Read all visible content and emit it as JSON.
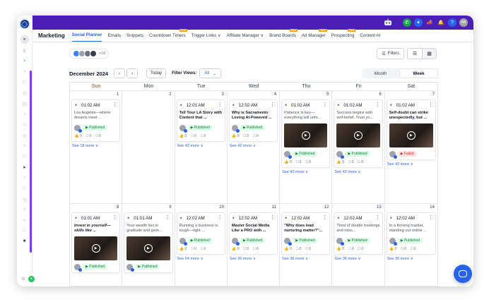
{
  "nav": {
    "title": "Marketing",
    "tabs": [
      {
        "label": "Social Planner",
        "active": true,
        "new": ""
      },
      {
        "label": "Emails",
        "active": false,
        "new": ""
      },
      {
        "label": "Snippets",
        "active": false,
        "new": ""
      },
      {
        "label": "Countdown Timers",
        "active": false,
        "new": "New"
      },
      {
        "label": "Trigger Links ∨",
        "active": false,
        "new": ""
      },
      {
        "label": "Affiliate Manager ∨",
        "active": false,
        "new": ""
      },
      {
        "label": "Brand Boards",
        "active": false,
        "new": "New"
      },
      {
        "label": "Ad Manager",
        "active": false,
        "new": "New"
      },
      {
        "label": "Prospecting",
        "active": false,
        "new": "New"
      },
      {
        "label": "Content AI",
        "active": false,
        "new": ""
      }
    ]
  },
  "toolbar": {
    "accounts_more": "+16",
    "filters_label": "Filters"
  },
  "daterow": {
    "month": "December 2024",
    "prev": "‹",
    "next": "›",
    "today": "Today",
    "filter_views_label": "Filter Views:",
    "filter_views_value": "All",
    "view_month": "Month",
    "view_week": "Week"
  },
  "calendar": {
    "weekdays": [
      "Sun",
      "Mon",
      "Tue",
      "Wed",
      "Thu",
      "Fri",
      "Sat"
    ],
    "weeks": [
      {
        "days": [
          {
            "num": "1",
            "post": null,
            "see_more": "See 18 more ∨"
          },
          {
            "num": "2",
            "post": null,
            "see_more": ""
          },
          {
            "num": "3",
            "post": {
              "time": "12:01 AM",
              "text": "Tell Your LA Story with Content that ...",
              "style": "bold",
              "media": false,
              "status": "Published",
              "likes": "0",
              "comments": "0",
              "shares": "0"
            },
            "see_more": "See 42 more ∨"
          },
          {
            "num": "4",
            "post": {
              "time": "12:02 AM",
              "text": "Why is Sacramento Loving AI-Powered ...",
              "style": "bold",
              "media": false,
              "status": "Published",
              "likes": "0",
              "comments": "0",
              "shares": "0"
            },
            "see_more": "See 42 more ∨"
          },
          {
            "num": "5",
            "post": {
              "time": "01:02 AM",
              "text": "Patience is key— everything will unfo...",
              "style": "normal",
              "media": true,
              "status": "Published",
              "likes": "0",
              "comments": "0",
              "shares": "0"
            },
            "see_more": "See 42 more ∨"
          },
          {
            "num": "6",
            "post": {
              "time": "01:02 AM",
              "text": "Success begins with self-belief. Trust yo...",
              "style": "normal",
              "media": true,
              "status": "Published",
              "likes": "0",
              "comments": "0",
              "shares": "0"
            },
            "see_more": "See 42 more ∨"
          },
          {
            "num": "7",
            "post": {
              "time": "01:02 AM",
              "text": "Self-doubt can strike unexpectedly, but ...",
              "style": "bold",
              "media": true,
              "status": "Failed",
              "likes": "",
              "comments": "",
              "shares": ""
            },
            "see_more": "See 42 more ∨"
          }
        ],
        "sun_post": {
          "time": "01:02 AM",
          "text": "Los Angeles—where dreams meet ...",
          "style": "normal",
          "media": false,
          "status": "Published",
          "likes": "0",
          "comments": "0",
          "shares": "0"
        }
      },
      {
        "days": [
          {
            "num": "8",
            "post": {
              "time": "01:01 AM",
              "text": "Invest in yourself— skills like ...",
              "style": "ital",
              "media": true,
              "status": "Published",
              "likes": "",
              "comments": "",
              "shares": ""
            },
            "see_more": ""
          },
          {
            "num": "9",
            "post": {
              "time": "01:01 AM",
              "text": "Your wealth lies in gratitude and givin...",
              "style": "normal",
              "media": true,
              "status": "Published",
              "likes": "",
              "comments": "",
              "shares": ""
            },
            "see_more": ""
          },
          {
            "num": "10",
            "post": {
              "time": "12:02 AM",
              "text": "Running a business is tough—tight ...",
              "style": "normal",
              "media": false,
              "status": "Published",
              "likes": "0",
              "comments": "0",
              "shares": "0"
            },
            "see_more": "See 54 more ∨"
          },
          {
            "num": "11",
            "post": {
              "time": "12:02 AM",
              "text": "Master Social Media Like a PRO with ...",
              "style": "bold",
              "media": false,
              "status": "Published",
              "likes": "0",
              "comments": "0",
              "shares": "0"
            },
            "see_more": "See 36 more ∨"
          },
          {
            "num": "12",
            "post": {
              "time": "12:02 AM",
              "text": "\"Why does lead nurturing matter?\"...",
              "style": "bold",
              "media": false,
              "status": "Published",
              "likes": "0",
              "comments": "0",
              "shares": "0"
            },
            "see_more": "See 36 more ∨"
          },
          {
            "num": "13",
            "post": {
              "time": "12:02 AM",
              "text": "Tired of double bookings and miss...",
              "style": "normal",
              "media": false,
              "status": "Published",
              "likes": "0",
              "comments": "0",
              "shares": "0"
            },
            "see_more": "See 36 more ∨"
          },
          {
            "num": "14",
            "post": {
              "time": "12:02 AM",
              "text": "In a thriving market, standing out online ...",
              "style": "normal",
              "media": false,
              "status": "Published",
              "likes": "0",
              "comments": "0",
              "shares": "0"
            },
            "see_more": "See 36 more ∨"
          }
        ]
      }
    ]
  },
  "colors": {
    "topbar": "#4b1fb5",
    "accent": "#2563eb",
    "published": "#15803d",
    "failed": "#dc2626"
  },
  "icons": {
    "robot": "robot-icon",
    "phone": "phone-icon",
    "bell": "bell-icon",
    "megaphone": "megaphone-icon",
    "help": "help-icon",
    "chat": "chat-icon"
  },
  "user": {
    "initials": "AB"
  }
}
